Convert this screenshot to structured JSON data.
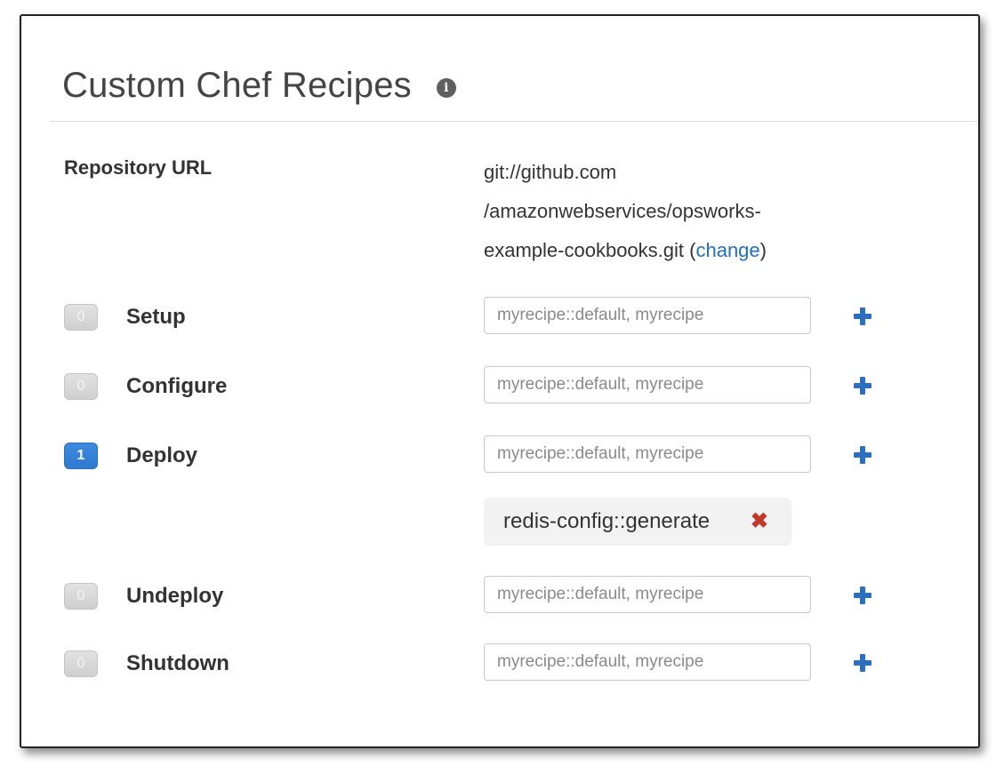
{
  "panel": {
    "title": "Custom Chef Recipes",
    "info_glyph": "i"
  },
  "repository": {
    "label": "Repository URL",
    "url_lines": [
      "git://github.com",
      "/amazonwebservices/opsworks-",
      "example-cookbooks.git"
    ],
    "change_prefix": "(",
    "change_link": "change",
    "change_suffix": ")"
  },
  "lifecycle_events": [
    {
      "count": "0",
      "label": "Setup",
      "placeholder": "myrecipe::default, myrecipe",
      "active": false
    },
    {
      "count": "0",
      "label": "Configure",
      "placeholder": "myrecipe::default, myrecipe",
      "active": false
    },
    {
      "count": "1",
      "label": "Deploy",
      "placeholder": "myrecipe::default, myrecipe",
      "active": true
    },
    {
      "count": "0",
      "label": "Undeploy",
      "placeholder": "myrecipe::default, myrecipe",
      "active": false
    },
    {
      "count": "0",
      "label": "Shutdown",
      "placeholder": "myrecipe::default, myrecipe",
      "active": false
    }
  ],
  "deploy_recipes": [
    {
      "name": "redis-config::generate",
      "remove_icon": "close-x-icon"
    }
  ],
  "colors": {
    "link": "#1f6fbf",
    "active_badge": "#2f79cf",
    "inactive_badge": "#d6d6d6",
    "plus_icon": "#2a6fc0",
    "remove_icon": "#c0392b"
  }
}
